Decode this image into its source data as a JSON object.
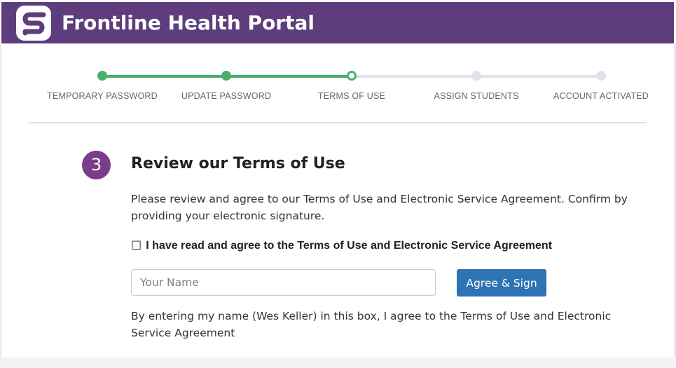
{
  "header": {
    "title": "Frontline Health Portal",
    "logo_icon": "frontline-logo-icon",
    "background_color": "#5e3d7c"
  },
  "stepper": {
    "active_color": "#4caf6e",
    "inactive_color": "#dfe3ea",
    "current_index": 2,
    "steps": [
      {
        "label": "TEMPORARY PASSWORD",
        "state": "complete"
      },
      {
        "label": "UPDATE PASSWORD",
        "state": "complete"
      },
      {
        "label": "TERMS OF USE",
        "state": "current"
      },
      {
        "label": "ASSIGN STUDENTS",
        "state": "upcoming"
      },
      {
        "label": "ACCOUNT ACTIVATED",
        "state": "upcoming"
      }
    ]
  },
  "section": {
    "step_number": "3",
    "title": "Review our Terms of Use",
    "intro": "Please review and agree to our Terms of Use and Electronic Service Agreement. Confirm by providing your electronic signature.",
    "checkbox_glyph": "☐",
    "checkbox_checked": false,
    "agree_label": "I have read and agree to the Terms of Use and Electronic Service Agreement",
    "name_input": {
      "value": "",
      "placeholder": "Your Name"
    },
    "sign_button_label": "Agree & Sign",
    "disclaimer": "By entering my name (Wes Keller) in this box, I agree to the Terms of Use and Electronic Service Agreement"
  }
}
